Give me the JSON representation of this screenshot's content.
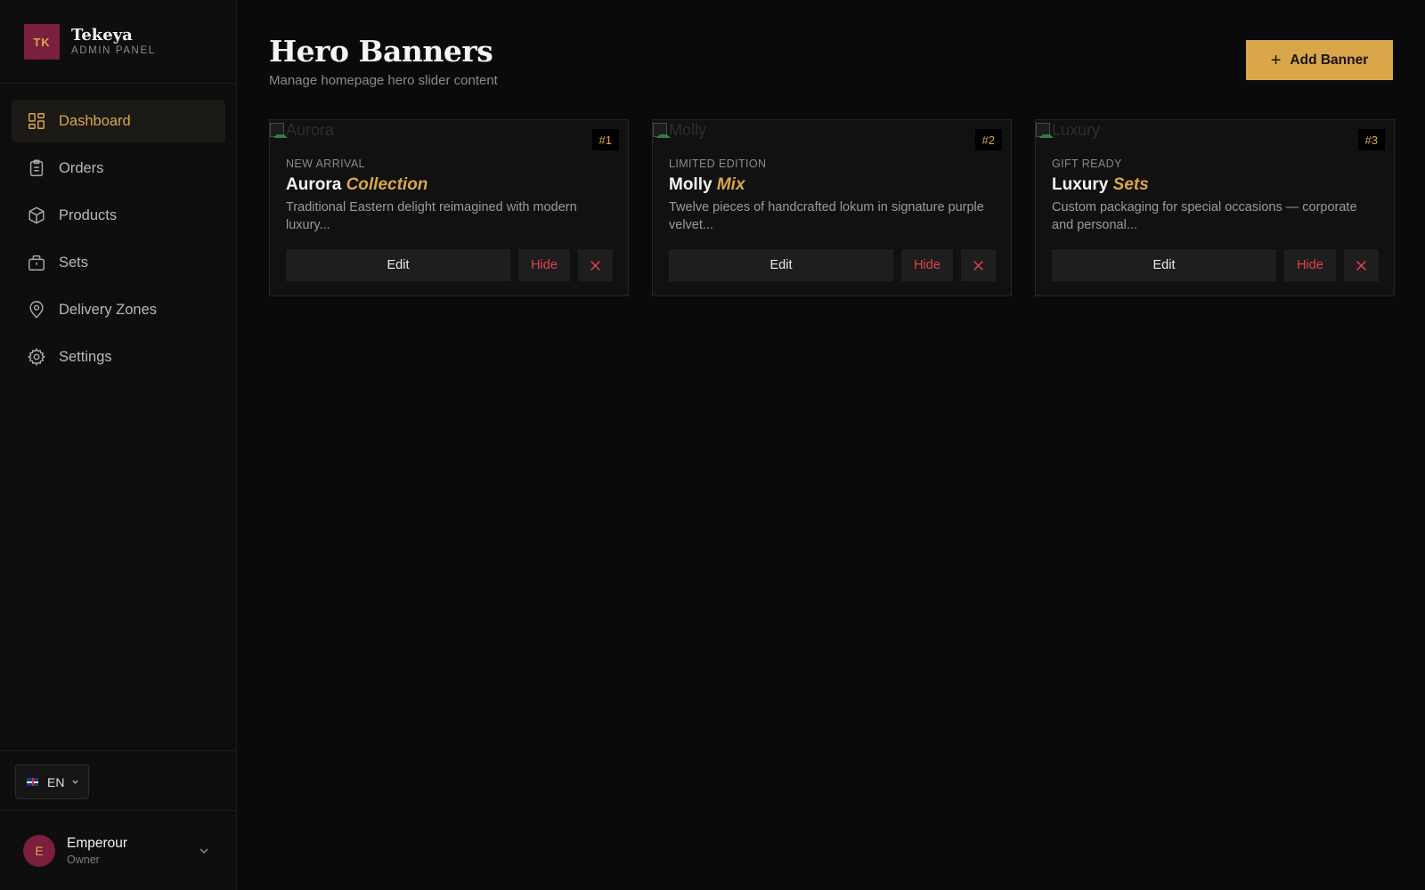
{
  "brand": {
    "logo_text": "TK",
    "name": "Tekeya",
    "subtitle": "ADMIN PANEL"
  },
  "nav": {
    "items": [
      {
        "label": "Dashboard",
        "icon": "dashboard-icon",
        "active": true
      },
      {
        "label": "Orders",
        "icon": "clipboard-icon",
        "active": false
      },
      {
        "label": "Products",
        "icon": "box-icon",
        "active": false
      },
      {
        "label": "Sets",
        "icon": "briefcase-icon",
        "active": false
      },
      {
        "label": "Delivery Zones",
        "icon": "map-pin-icon",
        "active": false
      },
      {
        "label": "Settings",
        "icon": "gear-icon",
        "active": false
      }
    ]
  },
  "language": {
    "code": "EN",
    "flag": "uk-flag-icon"
  },
  "user": {
    "initial": "E",
    "name": "Emperour",
    "role": "Owner"
  },
  "header": {
    "title": "Hero Banners",
    "subtitle": "Manage homepage hero slider content",
    "add_button_label": "Add Banner"
  },
  "banners": [
    {
      "image_alt": "Aurora",
      "badge": "#1",
      "tag": "NEW ARRIVAL",
      "title_main": "Aurora",
      "title_accent": "Collection",
      "description": "Traditional Eastern delight reimagined with modern luxury...",
      "edit_label": "Edit",
      "hide_label": "Hide"
    },
    {
      "image_alt": "Molly",
      "badge": "#2",
      "tag": "LIMITED EDITION",
      "title_main": "Molly",
      "title_accent": "Mix",
      "description": "Twelve pieces of handcrafted lokum in signature purple velvet...",
      "edit_label": "Edit",
      "hide_label": "Hide"
    },
    {
      "image_alt": "Luxury",
      "badge": "#3",
      "tag": "GIFT READY",
      "title_main": "Luxury",
      "title_accent": "Sets",
      "description": "Custom packaging for special occasions — corporate and personal...",
      "edit_label": "Edit",
      "hide_label": "Hide"
    }
  ],
  "colors": {
    "accent_gold": "#d9a74a",
    "brand_maroon": "#7a1f3d",
    "danger_red": "#e0414f",
    "background": "#0a0a0a"
  }
}
